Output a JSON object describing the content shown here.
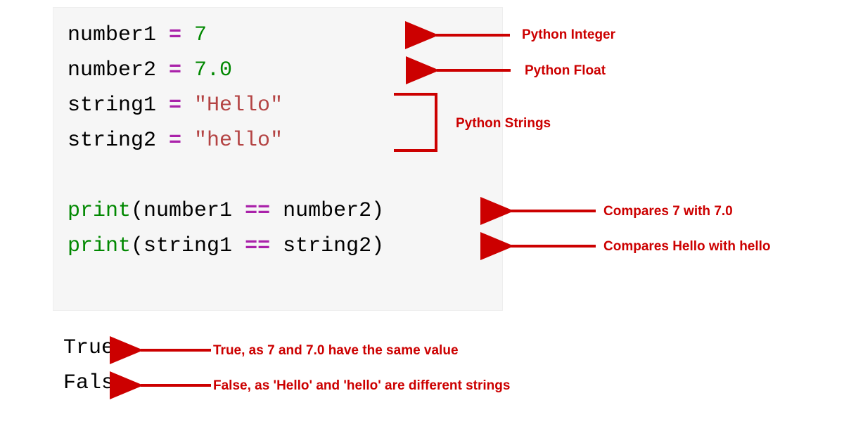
{
  "code": {
    "line1": {
      "var": "number1",
      "eq": " = ",
      "val": "7"
    },
    "line2": {
      "var": "number2",
      "eq": " = ",
      "val": "7.0"
    },
    "line3": {
      "var": "string1",
      "eq": " = ",
      "val": "\"Hello\""
    },
    "line4": {
      "var": "string2",
      "eq": " = ",
      "val": "\"hello\""
    },
    "line6": {
      "fn": "print",
      "open": "(",
      "arg1": "number1",
      "cmp": " == ",
      "arg2": "number2",
      "close": ")"
    },
    "line7": {
      "fn": "print",
      "open": "(",
      "arg1": "string1",
      "cmp": " == ",
      "arg2": "string2",
      "close": ")"
    }
  },
  "output": {
    "line1": "True",
    "line2": "False"
  },
  "annotations": {
    "int": "Python Integer",
    "float": "Python Float",
    "strings": "Python Strings",
    "cmp1": "Compares 7 with 7.0",
    "cmp2": "Compares Hello with hello",
    "out1": "True, as 7 and 7.0 have the same value",
    "out2": "False, as 'Hello' and 'hello' are different strings"
  }
}
